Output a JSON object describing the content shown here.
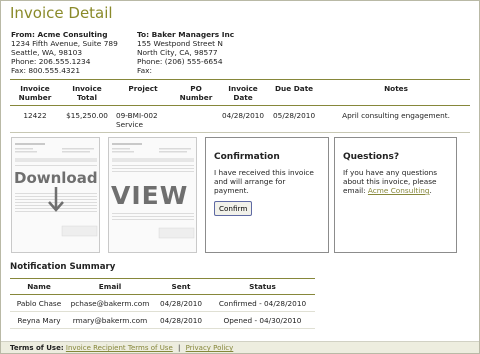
{
  "page_title": "Invoice Detail",
  "from": {
    "heading": "From: Acme Consulting",
    "lines": [
      "1234 Fifth Avenue, Suite 789",
      "Seattle, WA, 98103",
      "Phone: 206.555.1234",
      "Fax: 800.555.4321"
    ]
  },
  "to": {
    "heading": "To: Baker Managers Inc",
    "lines": [
      "155 Westpond Street N",
      "North City, CA, 98577",
      "Phone: (206) 555-6654",
      "Fax:"
    ]
  },
  "invoice_table": {
    "headers": [
      "Invoice Number",
      "Invoice Total",
      "Project",
      "PO Number",
      "Invoice Date",
      "Due Date",
      "Notes"
    ],
    "row": [
      "12422",
      "$15,250.00",
      "09-BMI-002 Service",
      "",
      "04/28/2010",
      "05/28/2010",
      "April consulting engagement."
    ]
  },
  "download_label": "Download",
  "view_label": "VIEW",
  "confirmation": {
    "title": "Confirmation",
    "text": "I have received this invoice and will arrange for payment.",
    "button": "Confirm"
  },
  "questions": {
    "title": "Questions?",
    "text": "If you have any questions about this invoice, please email:",
    "link": "Acme Consulting",
    "suffix": "."
  },
  "notification": {
    "title": "Notification Summary",
    "headers": [
      "Name",
      "Email",
      "Sent",
      "Status"
    ],
    "rows": [
      [
        "Pablo Chase",
        "pchase@bakerm.com",
        "04/28/2010",
        "Confirmed - 04/28/2010"
      ],
      [
        "Reyna Mary",
        "rmary@bakerm.com",
        "04/28/2010",
        "Opened - 04/30/2010"
      ]
    ]
  },
  "footer": {
    "label": "Terms of Use:",
    "link1": "Invoice Recipient Terms of Use",
    "sep": "|",
    "link2": "Privacy Policy"
  },
  "colors": {
    "accent": "#86873a",
    "title": "#8a8a2a",
    "footer_bg": "#ededdf"
  }
}
